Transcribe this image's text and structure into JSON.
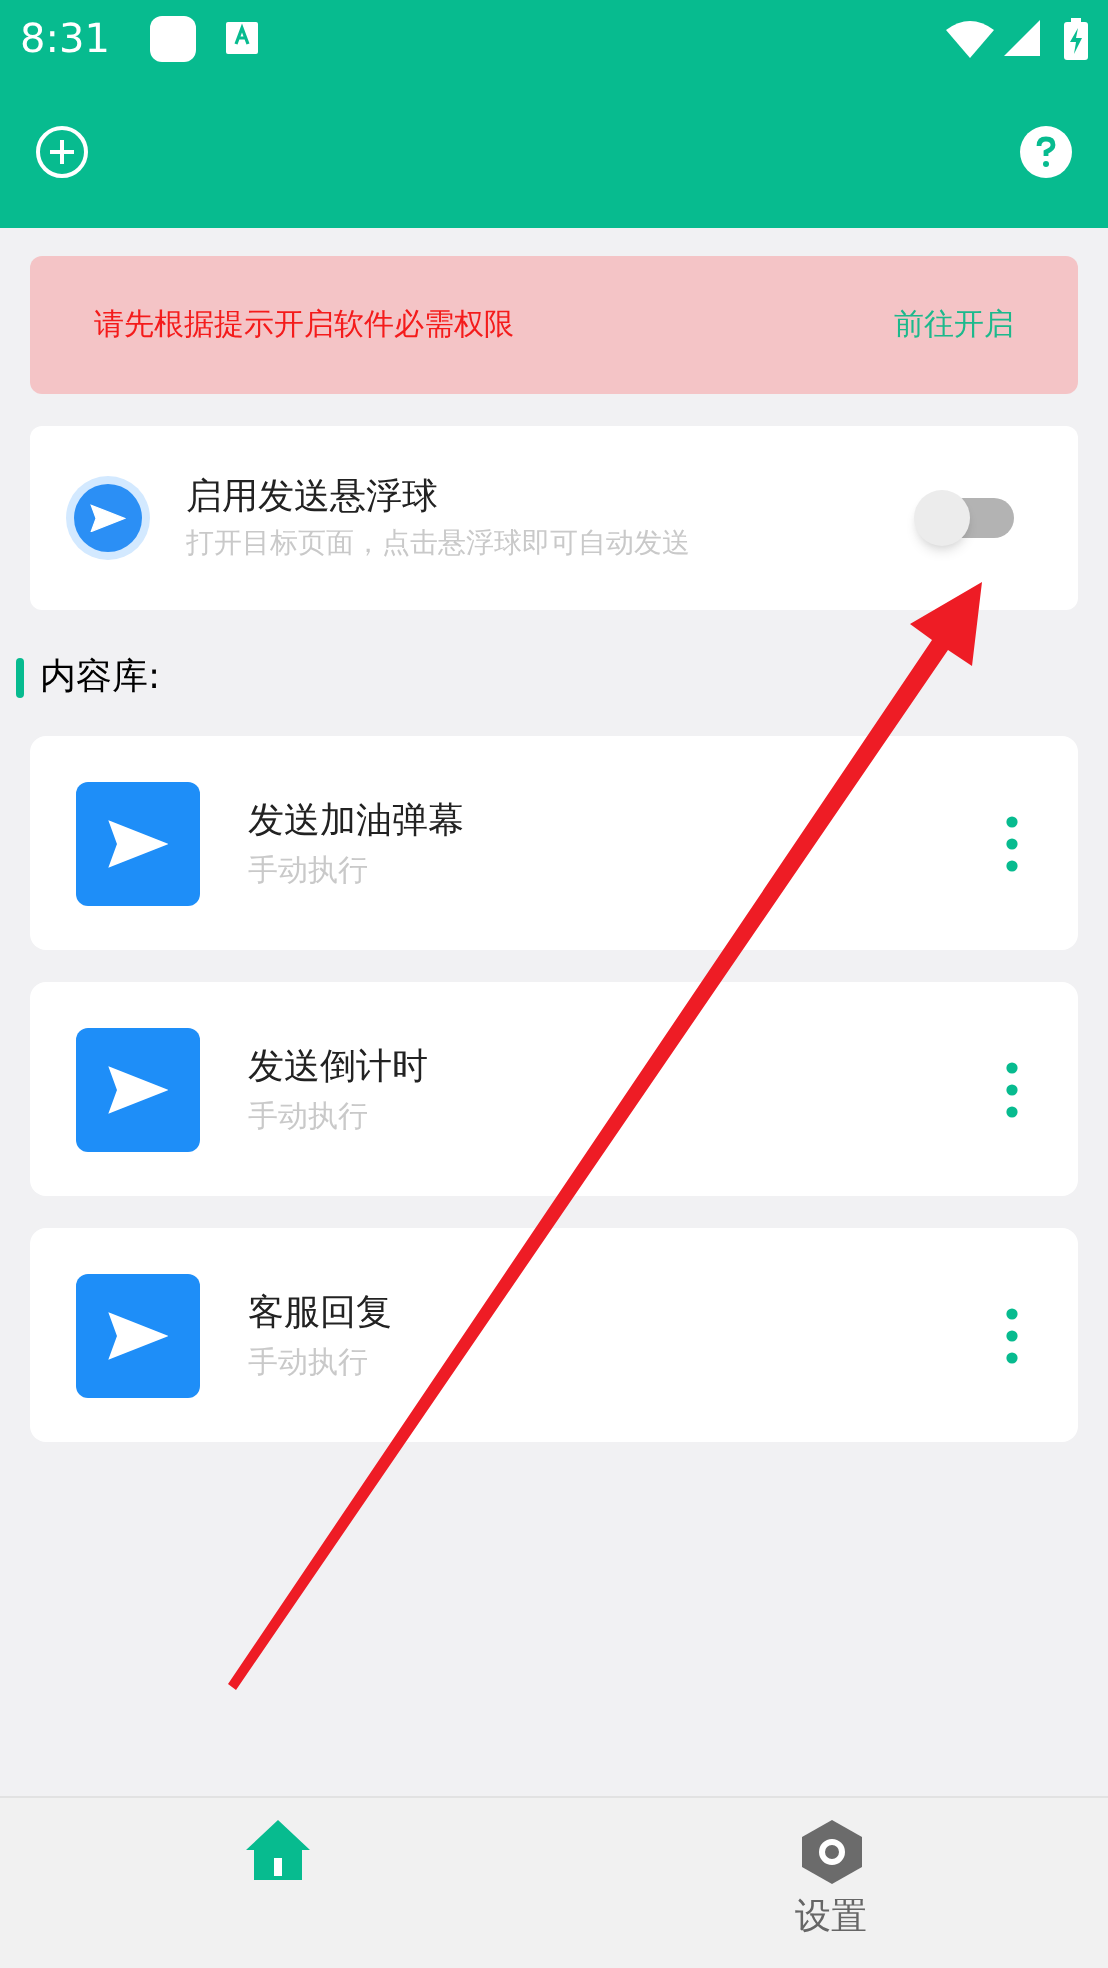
{
  "status_bar": {
    "time": "8:31"
  },
  "notice": {
    "message": "请先根据提示开启软件必需权限",
    "action": "前往开启"
  },
  "floating_ball": {
    "title": "启用发送悬浮球",
    "subtitle": "打开目标页面，点击悬浮球即可自动发送",
    "on": false
  },
  "section_title": "内容库:",
  "items": [
    {
      "title": "发送加油弹幕",
      "subtitle": "手动执行"
    },
    {
      "title": "发送倒计时",
      "subtitle": "手动执行"
    },
    {
      "title": "客服回复",
      "subtitle": "手动执行"
    }
  ],
  "bottom_nav": [
    {
      "kind": "home",
      "selected": true
    },
    {
      "kind": "settings",
      "label": "设置",
      "selected": false
    }
  ]
}
